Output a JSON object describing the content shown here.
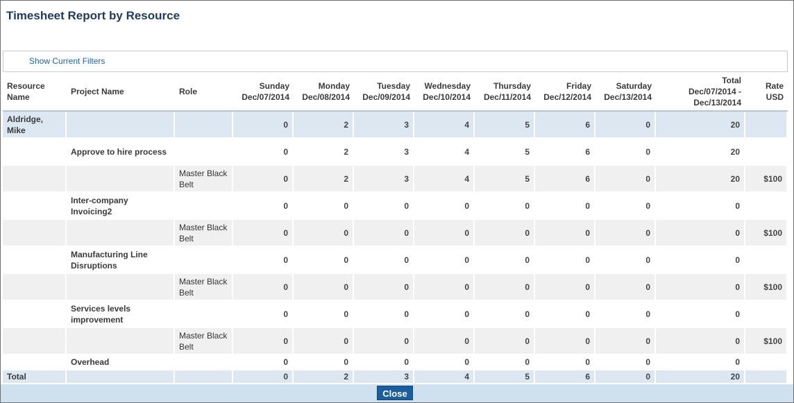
{
  "title": "Timesheet Report by Resource",
  "filters_link": "Show Current Filters",
  "headers": {
    "resource": "Resource Name",
    "project": "Project Name",
    "role": "Role",
    "days": [
      [
        "Sunday",
        "Dec/07/2014"
      ],
      [
        "Monday",
        "Dec/08/2014"
      ],
      [
        "Tuesday",
        "Dec/09/2014"
      ],
      [
        "Wednesday",
        "Dec/10/2014"
      ],
      [
        "Thursday",
        "Dec/11/2014"
      ],
      [
        "Friday",
        "Dec/12/2014"
      ],
      [
        "Saturday",
        "Dec/13/2014"
      ]
    ],
    "total": [
      "Total",
      "Dec/07/2014 -",
      "Dec/13/2014"
    ],
    "rate": [
      "Rate",
      "USD"
    ]
  },
  "rows": [
    {
      "type": "resource",
      "resource": "Aldridge, Mike",
      "project": "",
      "role": "",
      "values": [
        "0",
        "2",
        "3",
        "4",
        "5",
        "6",
        "0"
      ],
      "total": "20",
      "rate": ""
    },
    {
      "type": "project",
      "resource": "",
      "project": "Approve to hire process",
      "role": "",
      "values": [
        "0",
        "2",
        "3",
        "4",
        "5",
        "6",
        "0"
      ],
      "total": "20",
      "rate": ""
    },
    {
      "type": "role",
      "resource": "",
      "project": "",
      "role": "Master Black Belt",
      "values": [
        "0",
        "2",
        "3",
        "4",
        "5",
        "6",
        "0"
      ],
      "total": "20",
      "rate": "$100"
    },
    {
      "type": "project",
      "resource": "",
      "project": "Inter-company Invoicing2",
      "role": "",
      "values": [
        "0",
        "0",
        "0",
        "0",
        "0",
        "0",
        "0"
      ],
      "total": "0",
      "rate": ""
    },
    {
      "type": "role",
      "resource": "",
      "project": "",
      "role": "Master Black Belt",
      "values": [
        "0",
        "0",
        "0",
        "0",
        "0",
        "0",
        "0"
      ],
      "total": "0",
      "rate": "$100"
    },
    {
      "type": "project",
      "resource": "",
      "project": "Manufacturing Line Disruptions",
      "role": "",
      "values": [
        "0",
        "0",
        "0",
        "0",
        "0",
        "0",
        "0"
      ],
      "total": "0",
      "rate": ""
    },
    {
      "type": "role",
      "resource": "",
      "project": "",
      "role": "Master Black Belt",
      "values": [
        "0",
        "0",
        "0",
        "0",
        "0",
        "0",
        "0"
      ],
      "total": "0",
      "rate": "$100"
    },
    {
      "type": "project",
      "resource": "",
      "project": "Services levels improvement",
      "role": "",
      "values": [
        "0",
        "0",
        "0",
        "0",
        "0",
        "0",
        "0"
      ],
      "total": "0",
      "rate": ""
    },
    {
      "type": "role",
      "resource": "",
      "project": "",
      "role": "Master Black Belt",
      "values": [
        "0",
        "0",
        "0",
        "0",
        "0",
        "0",
        "0"
      ],
      "total": "0",
      "rate": "$100"
    },
    {
      "type": "project-short",
      "resource": "",
      "project": "Overhead",
      "role": "",
      "values": [
        "0",
        "0",
        "0",
        "0",
        "0",
        "0",
        "0"
      ],
      "total": "0",
      "rate": ""
    },
    {
      "type": "total",
      "resource": "Total",
      "project": "",
      "role": "",
      "values": [
        "0",
        "2",
        "3",
        "4",
        "5",
        "6",
        "0"
      ],
      "total": "20",
      "rate": ""
    }
  ],
  "close_label": "Close"
}
